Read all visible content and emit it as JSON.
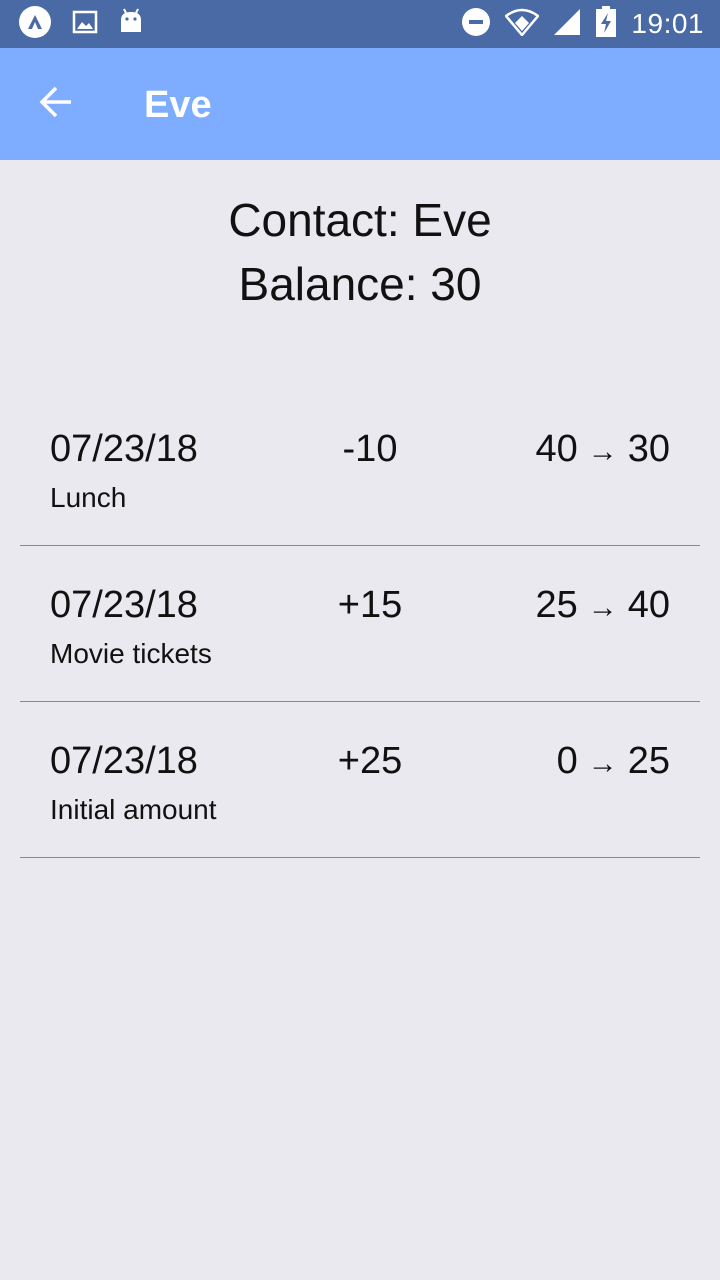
{
  "status_bar": {
    "time": "19:01",
    "icons_left": [
      "app-icon",
      "image-icon",
      "android-icon"
    ],
    "icons_right": [
      "do-not-disturb-icon",
      "wifi-icon",
      "signal-icon",
      "battery-charging-icon"
    ]
  },
  "app_bar": {
    "title": "Eve",
    "back_icon": "arrow-left-icon",
    "color": "#7eacfe"
  },
  "header": {
    "contact_line": "Contact: Eve",
    "balance_line": "Balance: 30"
  },
  "transactions": [
    {
      "date": "07/23/18",
      "description": "Lunch",
      "amount": "-10",
      "from": "40",
      "arrow": "→",
      "to": "30"
    },
    {
      "date": "07/23/18",
      "description": "Movie tickets",
      "amount": "+15",
      "from": "25",
      "arrow": "→",
      "to": "40"
    },
    {
      "date": "07/23/18",
      "description": "Initial amount",
      "amount": "+25",
      "from": "0",
      "arrow": "→",
      "to": "25"
    }
  ]
}
